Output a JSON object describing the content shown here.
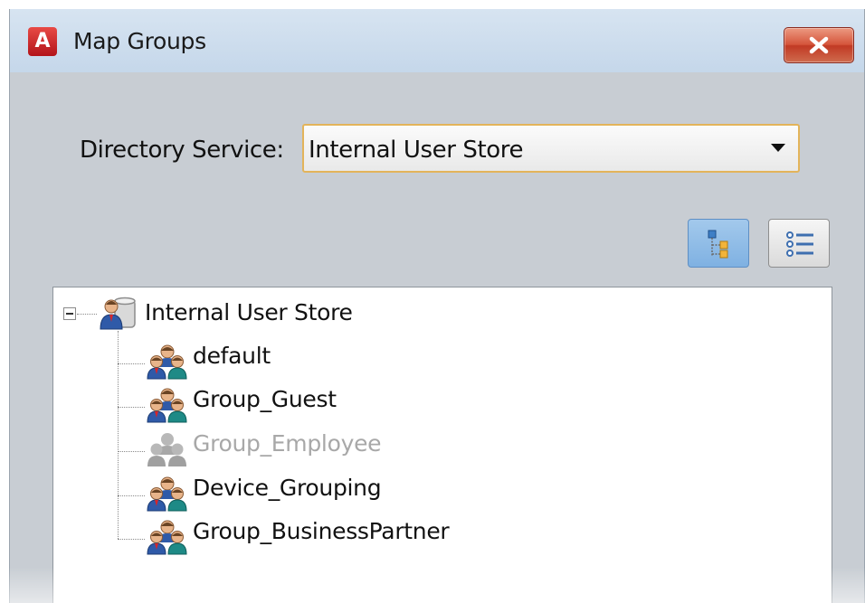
{
  "window": {
    "title": "Map Groups",
    "app_icon_letter": "A",
    "close_icon": "close-x-icon"
  },
  "directory_service": {
    "label": "Directory Service:",
    "selected": "Internal User Store"
  },
  "view_toggle": {
    "tree_view_icon": "tree-view-icon",
    "list_view_icon": "list-view-icon",
    "active": "tree"
  },
  "tree": {
    "root": {
      "label": "Internal User Store",
      "icon": "user-store-icon",
      "expanded": true
    },
    "children": [
      {
        "label": "default",
        "icon": "group-icon",
        "enabled": true
      },
      {
        "label": "Group_Guest",
        "icon": "group-icon",
        "enabled": true
      },
      {
        "label": "Group_Employee",
        "icon": "group-icon",
        "enabled": false
      },
      {
        "label": "Device_Grouping",
        "icon": "group-icon",
        "enabled": true
      },
      {
        "label": "Group_BusinessPartner",
        "icon": "group-icon",
        "enabled": true
      }
    ]
  },
  "colors": {
    "accent_border": "#e3b45a",
    "close_red": "#c13a24",
    "disabled_text": "#a8a8a8",
    "group_blue": "#2f5aa8",
    "group_teal": "#1e8a86"
  }
}
